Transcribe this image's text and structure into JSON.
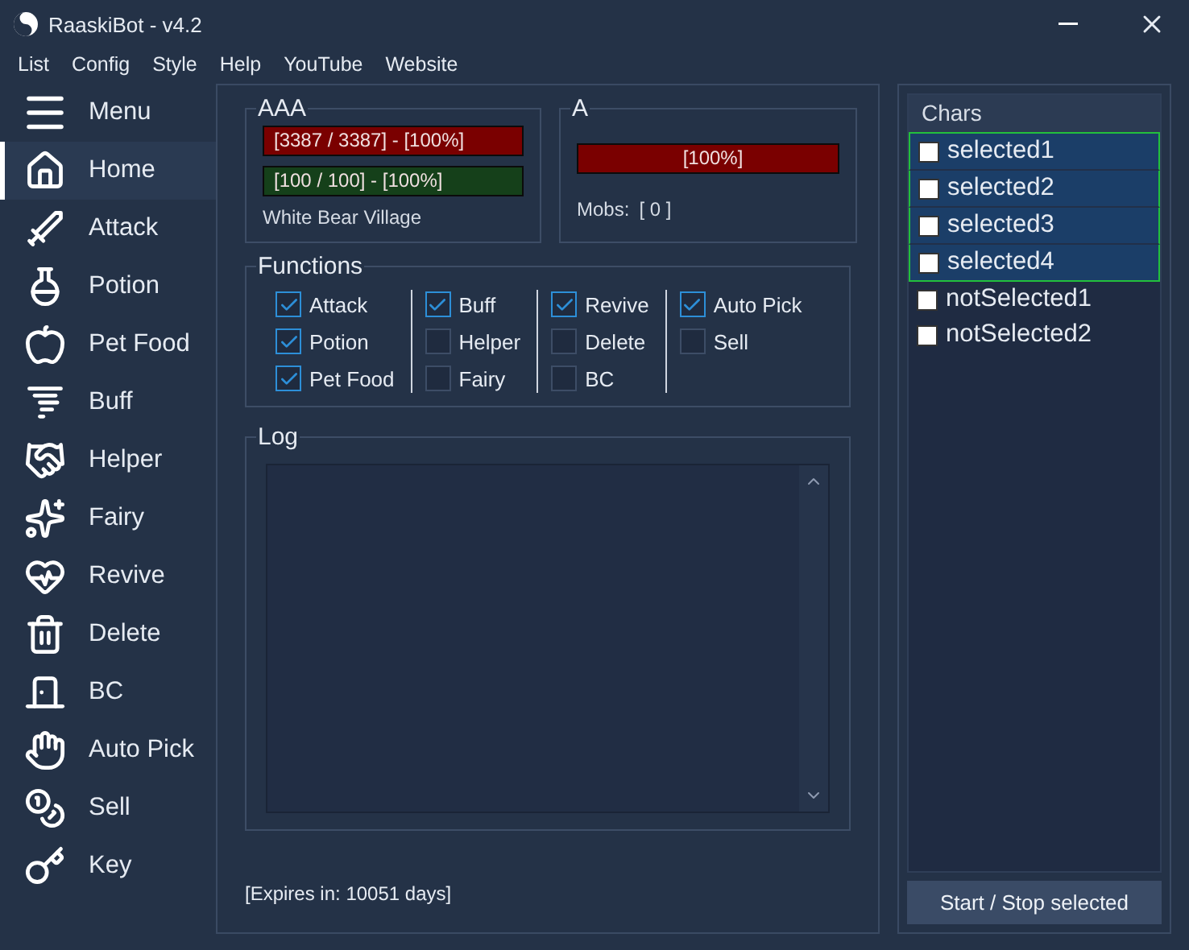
{
  "window": {
    "title": "RaaskiBot - v4.2"
  },
  "menu": [
    "List",
    "Config",
    "Style",
    "Help",
    "YouTube",
    "Website"
  ],
  "sidebar": {
    "items": [
      {
        "label": "Menu",
        "selected": false
      },
      {
        "label": "Home",
        "selected": true
      },
      {
        "label": "Attack",
        "selected": false
      },
      {
        "label": "Potion",
        "selected": false
      },
      {
        "label": "Pet Food",
        "selected": false
      },
      {
        "label": "Buff",
        "selected": false
      },
      {
        "label": "Helper",
        "selected": false
      },
      {
        "label": "Fairy",
        "selected": false
      },
      {
        "label": "Revive",
        "selected": false
      },
      {
        "label": "Delete",
        "selected": false
      },
      {
        "label": "BC",
        "selected": false
      },
      {
        "label": "Auto Pick",
        "selected": false
      },
      {
        "label": "Sell",
        "selected": false
      },
      {
        "label": "Key",
        "selected": false
      }
    ]
  },
  "player": {
    "title": "AAA",
    "hp": {
      "text": "[3387 / 3387] - [100%]",
      "level": 1
    },
    "mp": {
      "text": "[100 / 100] - [100%]",
      "level": 1
    },
    "location": "White Bear Village"
  },
  "target": {
    "title": "A",
    "hp": {
      "text": "[100%]",
      "level": 1
    },
    "mobs_label": "Mobs:",
    "mobs_value": "[ 0 ]"
  },
  "functions": {
    "title": "Functions",
    "columns": [
      [
        {
          "label": "Attack",
          "checked": true
        },
        {
          "label": "Potion",
          "checked": true
        },
        {
          "label": "Pet Food",
          "checked": true
        }
      ],
      [
        {
          "label": "Buff",
          "checked": true
        },
        {
          "label": "Helper",
          "checked": false
        },
        {
          "label": "Fairy",
          "checked": false
        }
      ],
      [
        {
          "label": "Revive",
          "checked": true
        },
        {
          "label": "Delete",
          "checked": false
        },
        {
          "label": "BC",
          "checked": false
        }
      ],
      [
        {
          "label": "Auto Pick",
          "checked": true
        },
        {
          "label": "Sell",
          "checked": false
        }
      ]
    ]
  },
  "log": {
    "title": "Log"
  },
  "expires": "[Expires in: 10051 days]",
  "chars": {
    "title": "Chars",
    "items": [
      {
        "name": "selected1",
        "selected": true,
        "checked": false
      },
      {
        "name": "selected2",
        "selected": true,
        "checked": false
      },
      {
        "name": "selected3",
        "selected": true,
        "checked": false
      },
      {
        "name": "selected4",
        "selected": true,
        "checked": false
      },
      {
        "name": "notSelected1",
        "selected": false,
        "checked": false
      },
      {
        "name": "notSelected2",
        "selected": false,
        "checked": false
      }
    ]
  },
  "start_button": "Start / Stop selected"
}
